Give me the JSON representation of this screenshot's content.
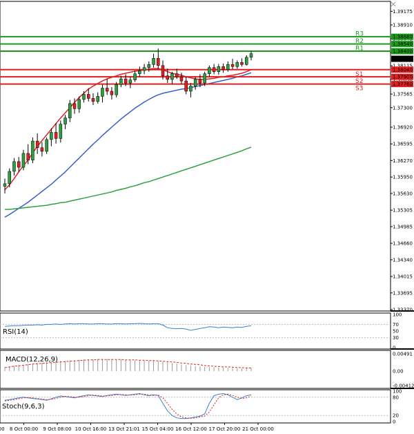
{
  "chart_data": [
    {
      "type": "candlestick",
      "title": "",
      "y_ticks": [
        "1.39175",
        "1.38910",
        "1.38645",
        "1.38380",
        "1.38115",
        "1.37850",
        "1.37565",
        "1.37300",
        "1.36920",
        "1.36595",
        "1.36270",
        "1.35950",
        "1.35630",
        "1.35305",
        "1.34985",
        "1.34660",
        "1.34340",
        "1.34015",
        "1.33695",
        "1.33370"
      ],
      "ylim": [
        1.3337,
        1.3918
      ],
      "x_labels": [
        "7 Oct 20:00",
        "8 Oct 00:00",
        "9 Oct 08:00",
        "10 Oct 16:00",
        "13 Oct 21:01",
        "15 Oct 04:00",
        "16 Oct 12:00",
        "17 Oct 20:00",
        "21 Oct 00:00"
      ],
      "current_price": "1.38251",
      "levels": [
        {
          "name": "R3",
          "value": "1.38680",
          "color": "#1a9a1a"
        },
        {
          "name": "R2",
          "value": "1.38540",
          "color": "#1a9a1a"
        },
        {
          "name": "R1",
          "value": "1.38400",
          "color": "#1a9a1a"
        },
        {
          "name": "S1",
          "value": "1.38040",
          "color": "#e02020"
        },
        {
          "name": "S2",
          "value": "1.37900",
          "color": "#e02020"
        },
        {
          "name": "S3",
          "value": "1.37760",
          "color": "#e02020"
        }
      ],
      "candles": [
        [
          1.3577,
          1.3592,
          1.3563,
          1.3582
        ],
        [
          1.3582,
          1.3612,
          1.3575,
          1.3606
        ],
        [
          1.3606,
          1.3632,
          1.3598,
          1.3625
        ],
        [
          1.3625,
          1.3634,
          1.3605,
          1.3614
        ],
        [
          1.3614,
          1.3648,
          1.3608,
          1.3641
        ],
        [
          1.3641,
          1.3659,
          1.362,
          1.3628
        ],
        [
          1.3628,
          1.3672,
          1.3622,
          1.3665
        ],
        [
          1.3665,
          1.368,
          1.364,
          1.3652
        ],
        [
          1.3652,
          1.3663,
          1.3635,
          1.3645
        ],
        [
          1.3645,
          1.3672,
          1.364,
          1.3668
        ],
        [
          1.3668,
          1.369,
          1.3655,
          1.3682
        ],
        [
          1.3682,
          1.37,
          1.366,
          1.367
        ],
        [
          1.367,
          1.3705,
          1.3662,
          1.3698
        ],
        [
          1.3698,
          1.3716,
          1.3688,
          1.371
        ],
        [
          1.371,
          1.3745,
          1.3702,
          1.3738
        ],
        [
          1.3738,
          1.3748,
          1.3718,
          1.3728
        ],
        [
          1.3728,
          1.3752,
          1.372,
          1.3746
        ],
        [
          1.3746,
          1.3762,
          1.374,
          1.3756
        ],
        [
          1.3756,
          1.3768,
          1.3742,
          1.3748
        ],
        [
          1.3748,
          1.3758,
          1.3735,
          1.3742
        ],
        [
          1.3742,
          1.376,
          1.3738,
          1.3752
        ],
        [
          1.3752,
          1.3775,
          1.374,
          1.3768
        ],
        [
          1.3768,
          1.3786,
          1.3755,
          1.3762
        ],
        [
          1.3762,
          1.377,
          1.3746,
          1.3755
        ],
        [
          1.3755,
          1.378,
          1.375,
          1.3775
        ],
        [
          1.3775,
          1.3792,
          1.377,
          1.3786
        ],
        [
          1.3786,
          1.3795,
          1.3772,
          1.3778
        ],
        [
          1.3778,
          1.379,
          1.3768,
          1.3784
        ],
        [
          1.3784,
          1.3802,
          1.378,
          1.3796
        ],
        [
          1.3796,
          1.381,
          1.379,
          1.3802
        ],
        [
          1.3802,
          1.3815,
          1.3795,
          1.3808
        ],
        [
          1.3808,
          1.382,
          1.38,
          1.3814
        ],
        [
          1.3814,
          1.3835,
          1.3808,
          1.3826
        ],
        [
          1.3826,
          1.3845,
          1.3805,
          1.3812
        ],
        [
          1.3812,
          1.3822,
          1.3785,
          1.3792
        ],
        [
          1.3792,
          1.3806,
          1.3778,
          1.3785
        ],
        [
          1.3785,
          1.38,
          1.3775,
          1.3796
        ],
        [
          1.3796,
          1.3806,
          1.3786,
          1.379
        ],
        [
          1.379,
          1.3798,
          1.3776,
          1.3782
        ],
        [
          1.3782,
          1.379,
          1.3756,
          1.3762
        ],
        [
          1.3762,
          1.3778,
          1.375,
          1.3772
        ],
        [
          1.3772,
          1.379,
          1.3765,
          1.3785
        ],
        [
          1.3785,
          1.3795,
          1.377,
          1.3778
        ],
        [
          1.3778,
          1.38,
          1.3772,
          1.3796
        ],
        [
          1.3796,
          1.3812,
          1.379,
          1.3808
        ],
        [
          1.3808,
          1.3815,
          1.3795,
          1.38
        ],
        [
          1.38,
          1.3815,
          1.3794,
          1.381
        ],
        [
          1.381,
          1.3816,
          1.3798,
          1.3804
        ],
        [
          1.3804,
          1.382,
          1.38,
          1.3814
        ],
        [
          1.3814,
          1.3825,
          1.3805,
          1.381
        ],
        [
          1.381,
          1.3822,
          1.3806,
          1.3818
        ],
        [
          1.3818,
          1.3826,
          1.381,
          1.3814
        ],
        [
          1.3814,
          1.3832,
          1.3812,
          1.3828
        ],
        [
          1.3828,
          1.384,
          1.3822,
          1.3835
        ]
      ],
      "moving_averages": [
        {
          "color": "#e02020",
          "values": [
            1.357,
            1.358,
            1.3592,
            1.3605,
            1.3617,
            1.3628,
            1.3642,
            1.3655,
            1.3666,
            1.3677,
            1.3688,
            1.3699,
            1.371,
            1.372,
            1.373,
            1.374,
            1.375,
            1.3758,
            1.3766,
            1.3772,
            1.3777,
            1.3782,
            1.3786,
            1.3789,
            1.3792,
            1.3795,
            1.3797,
            1.3799,
            1.3801,
            1.3802,
            1.3804,
            1.3805,
            1.3806,
            1.3806,
            1.3804,
            1.38,
            1.3797,
            1.3795,
            1.3793,
            1.379,
            1.3788,
            1.3786,
            1.3785,
            1.3785,
            1.3786,
            1.3787,
            1.3789,
            1.379,
            1.3792,
            1.3793,
            1.3795,
            1.3797,
            1.38,
            1.3804
          ]
        },
        {
          "color": "#3a5fcd",
          "values": [
            1.3517,
            1.3522,
            1.3528,
            1.3534,
            1.354,
            1.3546,
            1.3553,
            1.356,
            1.3567,
            1.3574,
            1.3581,
            1.3589,
            1.3597,
            1.3605,
            1.3614,
            1.3623,
            1.3632,
            1.3641,
            1.365,
            1.3659,
            1.3667,
            1.3676,
            1.3684,
            1.3692,
            1.37,
            1.3708,
            1.3715,
            1.3722,
            1.3729,
            1.3735,
            1.3741,
            1.3746,
            1.3751,
            1.3755,
            1.3758,
            1.376,
            1.3762,
            1.3764,
            1.3766,
            1.3767,
            1.3769,
            1.3771,
            1.3773,
            1.3775,
            1.3777,
            1.3779,
            1.3781,
            1.3783,
            1.3785,
            1.3787,
            1.379,
            1.3792,
            1.3795,
            1.3798
          ]
        },
        {
          "color": "#2ea043",
          "values": [
            1.3532,
            1.3532,
            1.3533,
            1.3534,
            1.3535,
            1.3536,
            1.3537,
            1.3538,
            1.3539,
            1.354,
            1.3542,
            1.3543,
            1.3545,
            1.3546,
            1.3548,
            1.355,
            1.3552,
            1.3554,
            1.3556,
            1.3558,
            1.356,
            1.3562,
            1.3564,
            1.3566,
            1.3569,
            1.3571,
            1.3573,
            1.3576,
            1.3578,
            1.3581,
            1.3584,
            1.3586,
            1.3589,
            1.3592,
            1.3595,
            1.3598,
            1.3601,
            1.3604,
            1.3607,
            1.361,
            1.3613,
            1.3616,
            1.3619,
            1.3622,
            1.3625,
            1.3628,
            1.3631,
            1.3634,
            1.3637,
            1.364,
            1.3643,
            1.3646,
            1.365,
            1.3653
          ]
        }
      ]
    },
    {
      "type": "line",
      "label": "RSI(14)",
      "y_ticks": [
        "100",
        "70",
        "50",
        "30",
        "0"
      ],
      "ylim": [
        0,
        100
      ],
      "series": [
        {
          "color": "#3a7fd5",
          "values": [
            64,
            65,
            66,
            66,
            67,
            68,
            68,
            69,
            68,
            70,
            70,
            71,
            70,
            71,
            72,
            71,
            72,
            72,
            71,
            71,
            72,
            72,
            71,
            71,
            72,
            72,
            71,
            72,
            72,
            73,
            72,
            71,
            72,
            72,
            68,
            60,
            58,
            57,
            58,
            56,
            52,
            55,
            58,
            60,
            63,
            62,
            60,
            62,
            61,
            60,
            62,
            61,
            64,
            66
          ]
        }
      ]
    },
    {
      "type": "bar",
      "label": "MACD(12,26,9)",
      "y_ticks": [
        "0.00491",
        "0.00",
        "-0.00412"
      ],
      "ylim": [
        -0.00412,
        0.00491
      ],
      "histogram": [
        0.0011,
        0.0013,
        0.0015,
        0.0017,
        0.0018,
        0.002,
        0.0021,
        0.0023,
        0.0024,
        0.0025,
        0.0026,
        0.0027,
        0.0028,
        0.0029,
        0.003,
        0.0031,
        0.0032,
        0.0033,
        0.0033,
        0.0034,
        0.0034,
        0.0034,
        0.0034,
        0.0034,
        0.0033,
        0.0033,
        0.0032,
        0.0032,
        0.0031,
        0.0031,
        0.003,
        0.0029,
        0.0029,
        0.0028,
        0.0027,
        0.0025,
        0.0023,
        0.0021,
        0.0019,
        0.0017,
        0.0016,
        0.0014,
        0.0013,
        0.0012,
        0.0011,
        0.0011,
        0.001,
        0.001,
        0.0009,
        0.0009,
        0.0008,
        0.0008,
        0.0008,
        0.0008
      ],
      "signal": [
        0.001,
        0.0012,
        0.0014,
        0.0015,
        0.0017,
        0.0018,
        0.002,
        0.0021,
        0.0022,
        0.0023,
        0.0024,
        0.0025,
        0.0026,
        0.0027,
        0.0028,
        0.0029,
        0.003,
        0.0031,
        0.0032,
        0.0032,
        0.0033,
        0.0033,
        0.0033,
        0.0033,
        0.0033,
        0.0033,
        0.0032,
        0.0032,
        0.0032,
        0.0031,
        0.0031,
        0.003,
        0.003,
        0.0029,
        0.0028,
        0.0027,
        0.0026,
        0.0025,
        0.0023,
        0.0022,
        0.002,
        0.0019,
        0.0018,
        0.0016,
        0.0015,
        0.0014,
        0.0013,
        0.0012,
        0.0012,
        0.0011,
        0.001,
        0.001,
        0.0009,
        0.0009
      ]
    },
    {
      "type": "line",
      "label": "Stoch(9,6,3)",
      "y_ticks": [
        "100",
        "80",
        "20",
        "0"
      ],
      "ylim": [
        0,
        100
      ],
      "series": [
        {
          "color": "#3a7fd5",
          "values": [
            70,
            72,
            75,
            78,
            80,
            78,
            76,
            74,
            72,
            70,
            75,
            80,
            84,
            82,
            80,
            78,
            82,
            85,
            88,
            86,
            84,
            82,
            86,
            88,
            90,
            88,
            86,
            88,
            90,
            92,
            88,
            85,
            88,
            86,
            60,
            35,
            20,
            12,
            10,
            10,
            12,
            15,
            18,
            25,
            60,
            85,
            90,
            92,
            88,
            80,
            72,
            78,
            85,
            88
          ]
        },
        {
          "color": "#e02020",
          "values": [
            68,
            70,
            72,
            75,
            78,
            79,
            78,
            76,
            74,
            72,
            73,
            76,
            80,
            83,
            82,
            80,
            80,
            82,
            85,
            87,
            86,
            84,
            84,
            86,
            88,
            89,
            88,
            87,
            88,
            90,
            90,
            88,
            86,
            87,
            78,
            60,
            40,
            25,
            15,
            12,
            11,
            12,
            15,
            18,
            32,
            55,
            78,
            88,
            90,
            86,
            80,
            76,
            78,
            84
          ]
        }
      ]
    }
  ]
}
